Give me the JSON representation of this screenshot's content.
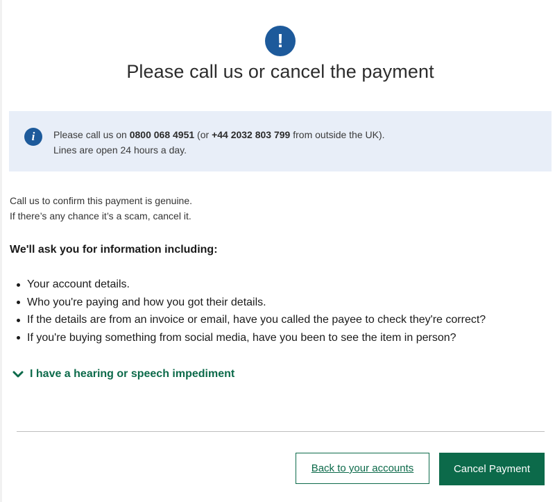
{
  "header": {
    "alert_glyph": "!",
    "title": "Please call us or cancel the payment"
  },
  "info_box": {
    "icon_glyph": "i",
    "line1_prefix": "Please call us on ",
    "uk_number": "0800 068 4951",
    "line1_middle": " (or ",
    "intl_number": "+44 2032 803 799",
    "line1_suffix": " from outside the UK).",
    "line2": "Lines are open 24 hours a day."
  },
  "confirm": {
    "line1": "Call us to confirm this payment is genuine.",
    "line2": "If there’s any chance it’s a scam, cancel it."
  },
  "ask_heading": "We'll ask you for information including:",
  "info_items": [
    "Your account details.",
    "Who you're paying and how you got their details.",
    "If the details are from an invoice or email, have you called the payee to check they're correct?",
    "If you're buying something from social media, have you been to see the item in person?"
  ],
  "accordion": {
    "label": "I have a hearing or speech impediment",
    "icon": "chevron-down-icon"
  },
  "buttons": {
    "back_label": "Back to your accounts",
    "cancel_label": "Cancel Payment"
  },
  "colors": {
    "brand_green": "#0c6a4a",
    "info_blue": "#1d5a9b",
    "info_background": "#e8eef8"
  }
}
